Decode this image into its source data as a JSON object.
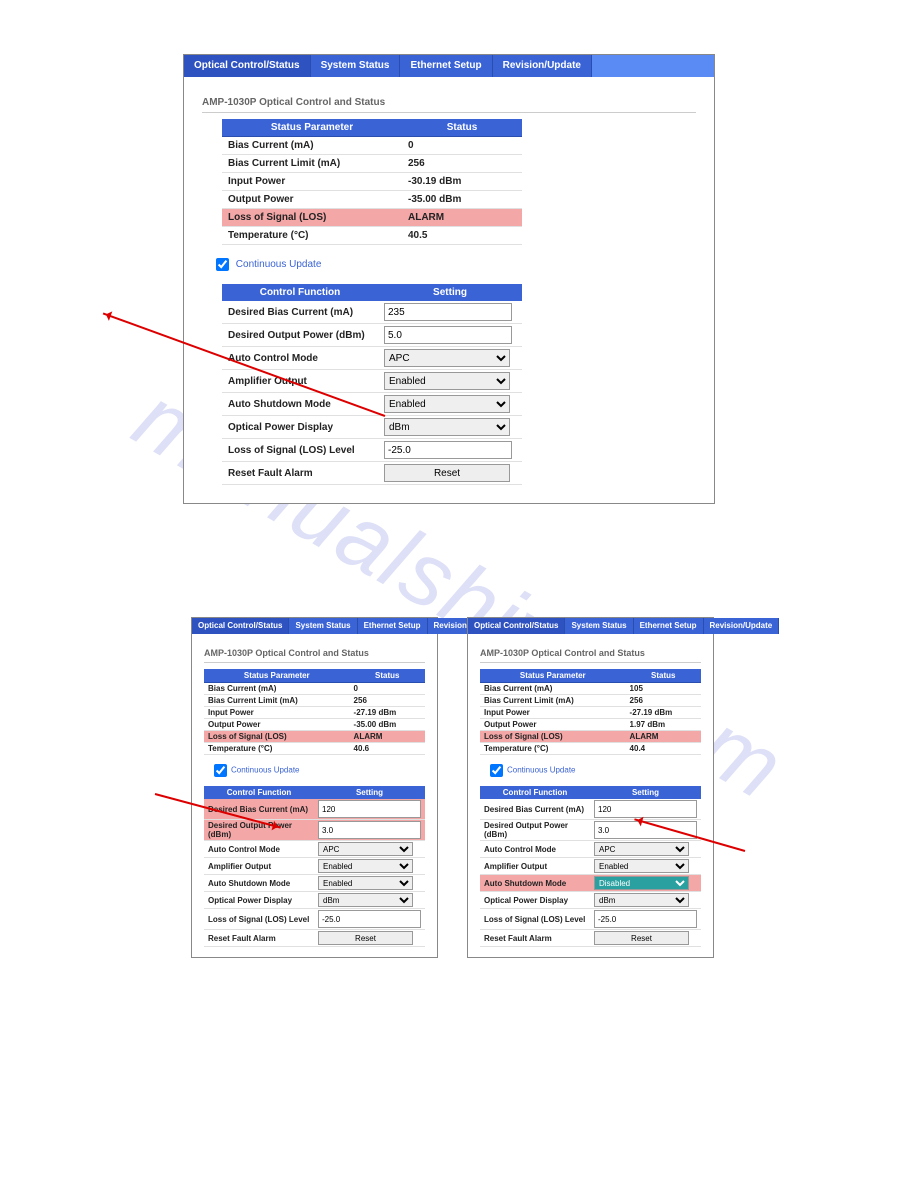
{
  "watermark": "manualshive.com",
  "tabs": {
    "t1": "Optical Control/Status",
    "t2": "System Status",
    "t3": "Ethernet Setup",
    "t4": "Revision/Update"
  },
  "main": {
    "title": "AMP-1030P Optical Control and Status",
    "statusHeader": {
      "param": "Status Parameter",
      "status": "Status"
    },
    "status": {
      "biasCurrent": {
        "label": "Bias Current (mA)",
        "value": "0"
      },
      "biasLimit": {
        "label": "Bias Current Limit (mA)",
        "value": "256"
      },
      "inputPower": {
        "label": "Input Power",
        "value": "-30.19 dBm"
      },
      "outputPower": {
        "label": "Output Power",
        "value": "-35.00 dBm"
      },
      "los": {
        "label": "Loss of Signal (LOS)",
        "value": "ALARM"
      },
      "temp": {
        "label": "Temperature (°C)",
        "value": "40.5"
      }
    },
    "continuous": "Continuous Update",
    "ctrlHeader": {
      "fn": "Control Function",
      "set": "Setting"
    },
    "ctrl": {
      "bias": {
        "label": "Desired Bias Current (mA)",
        "value": "235"
      },
      "out": {
        "label": "Desired Output Power (dBm)",
        "value": "5.0"
      },
      "mode": {
        "label": "Auto Control Mode",
        "value": "APC"
      },
      "amp": {
        "label": "Amplifier Output",
        "value": "Enabled"
      },
      "asd": {
        "label": "Auto Shutdown Mode",
        "value": "Enabled"
      },
      "disp": {
        "label": "Optical Power Display",
        "value": "dBm"
      },
      "losl": {
        "label": "Loss of Signal (LOS) Level",
        "value": "-25.0"
      },
      "reset": {
        "label": "Reset Fault Alarm",
        "button": "Reset"
      }
    }
  },
  "small1": {
    "title": "AMP-1030P Optical Control and Status",
    "status": {
      "biasCurrent": "0",
      "biasLimit": "256",
      "inputPower": "-27.19 dBm",
      "outputPower": "-35.00 dBm",
      "los": "ALARM",
      "temp": "40.6"
    },
    "ctrl": {
      "bias": "120",
      "out": "3.0",
      "mode": "APC",
      "amp": "Enabled",
      "asd": "Enabled",
      "disp": "dBm",
      "losl": "-25.0"
    }
  },
  "small2": {
    "title": "AMP-1030P Optical Control and Status",
    "status": {
      "biasCurrent": "105",
      "biasLimit": "256",
      "inputPower": "-27.19 dBm",
      "outputPower": "1.97 dBm",
      "los": "ALARM",
      "temp": "40.4"
    },
    "ctrl": {
      "bias": "120",
      "out": "3.0",
      "mode": "APC",
      "amp": "Enabled",
      "asd": "Disabled",
      "disp": "dBm",
      "losl": "-25.0"
    }
  }
}
